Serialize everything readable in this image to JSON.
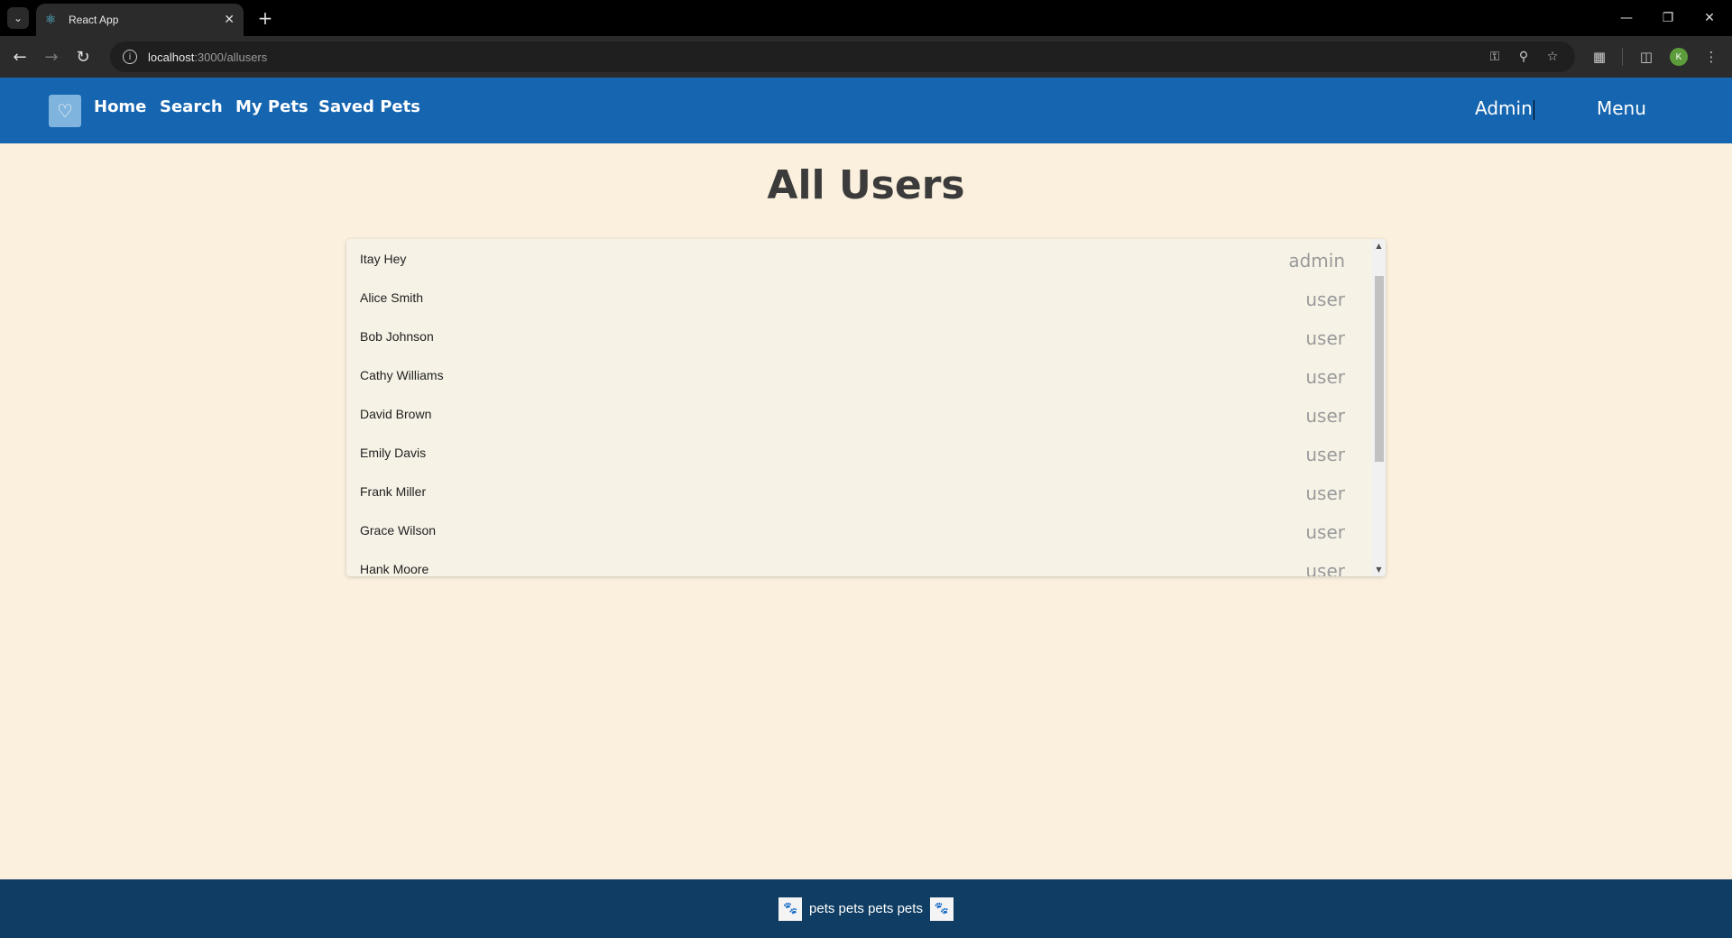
{
  "browser": {
    "tab_title": "React App",
    "url_host": "localhost",
    "url_path": ":3000/allusers",
    "profile_initial": "K"
  },
  "nav": {
    "links": [
      "Home",
      "Search",
      "My Pets",
      "Saved Pets"
    ],
    "admin_label": "Admin",
    "menu_label": "Menu"
  },
  "page": {
    "title": "All Users"
  },
  "users": [
    {
      "name": "Itay Hey",
      "role": "admin"
    },
    {
      "name": "Alice Smith",
      "role": "user"
    },
    {
      "name": "Bob Johnson",
      "role": "user"
    },
    {
      "name": "Cathy Williams",
      "role": "user"
    },
    {
      "name": "David Brown",
      "role": "user"
    },
    {
      "name": "Emily Davis",
      "role": "user"
    },
    {
      "name": "Frank Miller",
      "role": "user"
    },
    {
      "name": "Grace Wilson",
      "role": "user"
    },
    {
      "name": "Hank Moore",
      "role": "user"
    }
  ],
  "footer": {
    "text": "pets pets pets pets"
  },
  "colors": {
    "nav_bg": "#1565b0",
    "page_bg": "#faf0dd",
    "footer_bg": "#0f3d63"
  }
}
